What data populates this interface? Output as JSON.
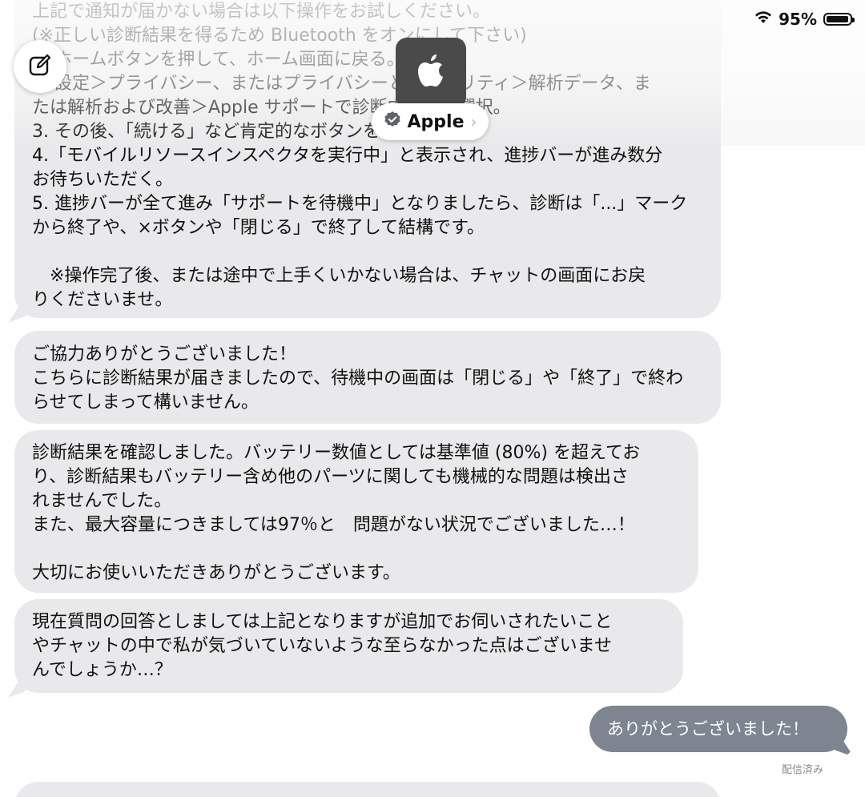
{
  "status_bar": {
    "battery_percent": "95%",
    "battery_level": 0.95
  },
  "header": {
    "contact_name": "Apple",
    "avatar_icon": "apple-logo-icon",
    "verified_icon": "verified-badge-icon",
    "chevron": "›",
    "compose_icon": "compose-icon"
  },
  "messages": [
    {
      "direction": "incoming",
      "lines": [
        "上記で通知が届かない場合は以下操作をお試しください。",
        "(※正しい診断結果を得るため Bluetooth をオンにして下さい)",
        "1. ホームボタンを押して、ホーム画面に戻る。",
        "2. 設定＞プライバシー、またはプライバシーとセキュリティ＞解析データ、ま",
        "たは解析および改善＞Apple サポートで診断中の順に選択。",
        "3. その後、「続ける」など肯定的なボタンをタップ。",
        "4.「モバイルリソースインスペクタを実行中」と表示され、進捗バーが進み数分",
        "お待ちいただく。",
        "5. 進捗バーが全て進み「サポートを待機中」となりましたら、診断は「...」マーク",
        "から終了や、×ボタンや「閉じる」で終了して結構です。",
        "",
        "　※操作完了後、または途中で上手くいかない場合は、チャットの画面にお戻",
        "りくださいませ。"
      ]
    },
    {
      "direction": "incoming",
      "lines": [
        "ご協力ありがとうございました！",
        "こちらに診断結果が届きましたので、待機中の画面は「閉じる」や「終了」で終わ",
        "らせてしまって構いません。"
      ]
    },
    {
      "direction": "incoming",
      "lines": [
        "診断結果を確認しました。バッテリー数値としては基準値 (80%) を超えてお",
        "り、診断結果もバッテリー含め他のパーツに関しても機械的な問題は検出さ",
        "れませんでした。",
        "また、最大容量につきましては97％と　問題がない状況でございました…！",
        "",
        "大切にお使いいただきありがとうございます。"
      ]
    },
    {
      "direction": "incoming",
      "lines": [
        "現在質問の回答としましては上記となりますが追加でお伺いされたいこと",
        "やチャットの中で私が気づいていないような至らなかった点はございませ",
        "んでしょうか…？"
      ]
    },
    {
      "direction": "outgoing",
      "lines": [
        "ありがとうございました！"
      ]
    }
  ],
  "delivery_status": "配信済み",
  "colors": {
    "incoming_bubble": "#e9e9eb",
    "outgoing_bubble": "#7c8590"
  }
}
